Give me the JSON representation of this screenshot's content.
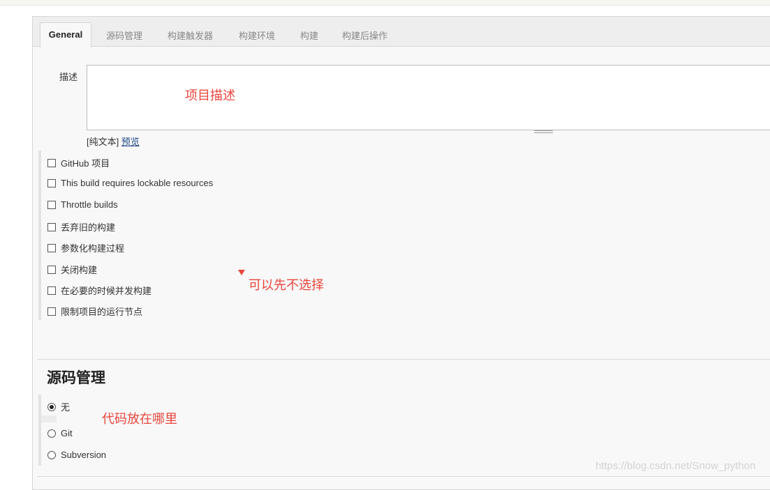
{
  "tabs": [
    {
      "label": "General",
      "active": true
    },
    {
      "label": "源码管理"
    },
    {
      "label": "构建触发器"
    },
    {
      "label": "构建环境"
    },
    {
      "label": "构建"
    },
    {
      "label": "构建后操作"
    }
  ],
  "description": {
    "label": "描述",
    "value": "",
    "annotation": "项目描述",
    "format_prefix": "[纯文本]",
    "preview_link": "预览"
  },
  "options": [
    {
      "label": "GitHub 项目",
      "checked": false
    },
    {
      "label": "This build requires lockable resources",
      "checked": false
    },
    {
      "label": "Throttle builds",
      "checked": false
    },
    {
      "label": "丢弃旧的构建",
      "checked": false
    },
    {
      "label": "参数化构建过程",
      "checked": false
    },
    {
      "label": "关闭构建",
      "checked": false
    },
    {
      "label": "在必要的时候并发构建",
      "checked": false
    },
    {
      "label": "限制项目的运行节点",
      "checked": false
    }
  ],
  "options_annotation": "可以先不选择",
  "scm": {
    "title": "源码管理",
    "annotation": "代码放在哪里",
    "choices": [
      {
        "label": "无",
        "selected": true
      },
      {
        "label": "Git",
        "selected": false
      },
      {
        "label": "Subversion",
        "selected": false
      }
    ]
  },
  "watermark": "https://blog.csdn.net/Snow_python",
  "colors": {
    "annotation": "#e8453c",
    "link": "#204a87"
  }
}
